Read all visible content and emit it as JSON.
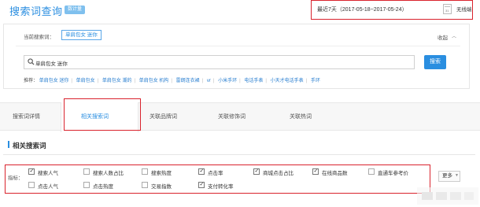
{
  "header": {
    "title": "搜索词查询",
    "badge": "数计量",
    "date_range": "最近7天（2017-05-18~2017-05-24）",
    "terminal": "无线端"
  },
  "search_panel": {
    "current_label": "当前搜索词：",
    "current_term": "单肩包女 迷你",
    "collapse_label": "收起",
    "input_value": "单肩包女 迷你",
    "search_button": "搜索",
    "recommend_label": "推荐：",
    "recommendations": [
      "单肩包女 迷你",
      "单肩包女",
      "单肩包女 潮的",
      "单肩包女 机构",
      "雷朗连衣裙",
      "vr",
      "小米手环",
      "电话手表",
      "小天才电话手表",
      "手环"
    ]
  },
  "tabs": [
    {
      "label": "搜索词详情",
      "active": false
    },
    {
      "label": "相关搜索词",
      "active": true
    },
    {
      "label": "关联品牌词",
      "active": false
    },
    {
      "label": "关联修饰词",
      "active": false
    },
    {
      "label": "关联热词",
      "active": false
    }
  ],
  "section": {
    "title": "相关搜索词"
  },
  "indicators": {
    "label": "指标：",
    "more_button": "更多",
    "items": [
      {
        "label": "搜索人气",
        "checked": true
      },
      {
        "label": "搜索人数占比",
        "checked": false
      },
      {
        "label": "搜索热度",
        "checked": false
      },
      {
        "label": "点击率",
        "checked": true
      },
      {
        "label": "商城点击占比",
        "checked": true
      },
      {
        "label": "在线商品数",
        "checked": true
      },
      {
        "label": "直通车参考价",
        "checked": false
      },
      {
        "label": "点击人气",
        "checked": false
      },
      {
        "label": "点击热度",
        "checked": false
      },
      {
        "label": "交易指数",
        "checked": false
      },
      {
        "label": "支付转化率",
        "checked": true
      }
    ]
  }
}
